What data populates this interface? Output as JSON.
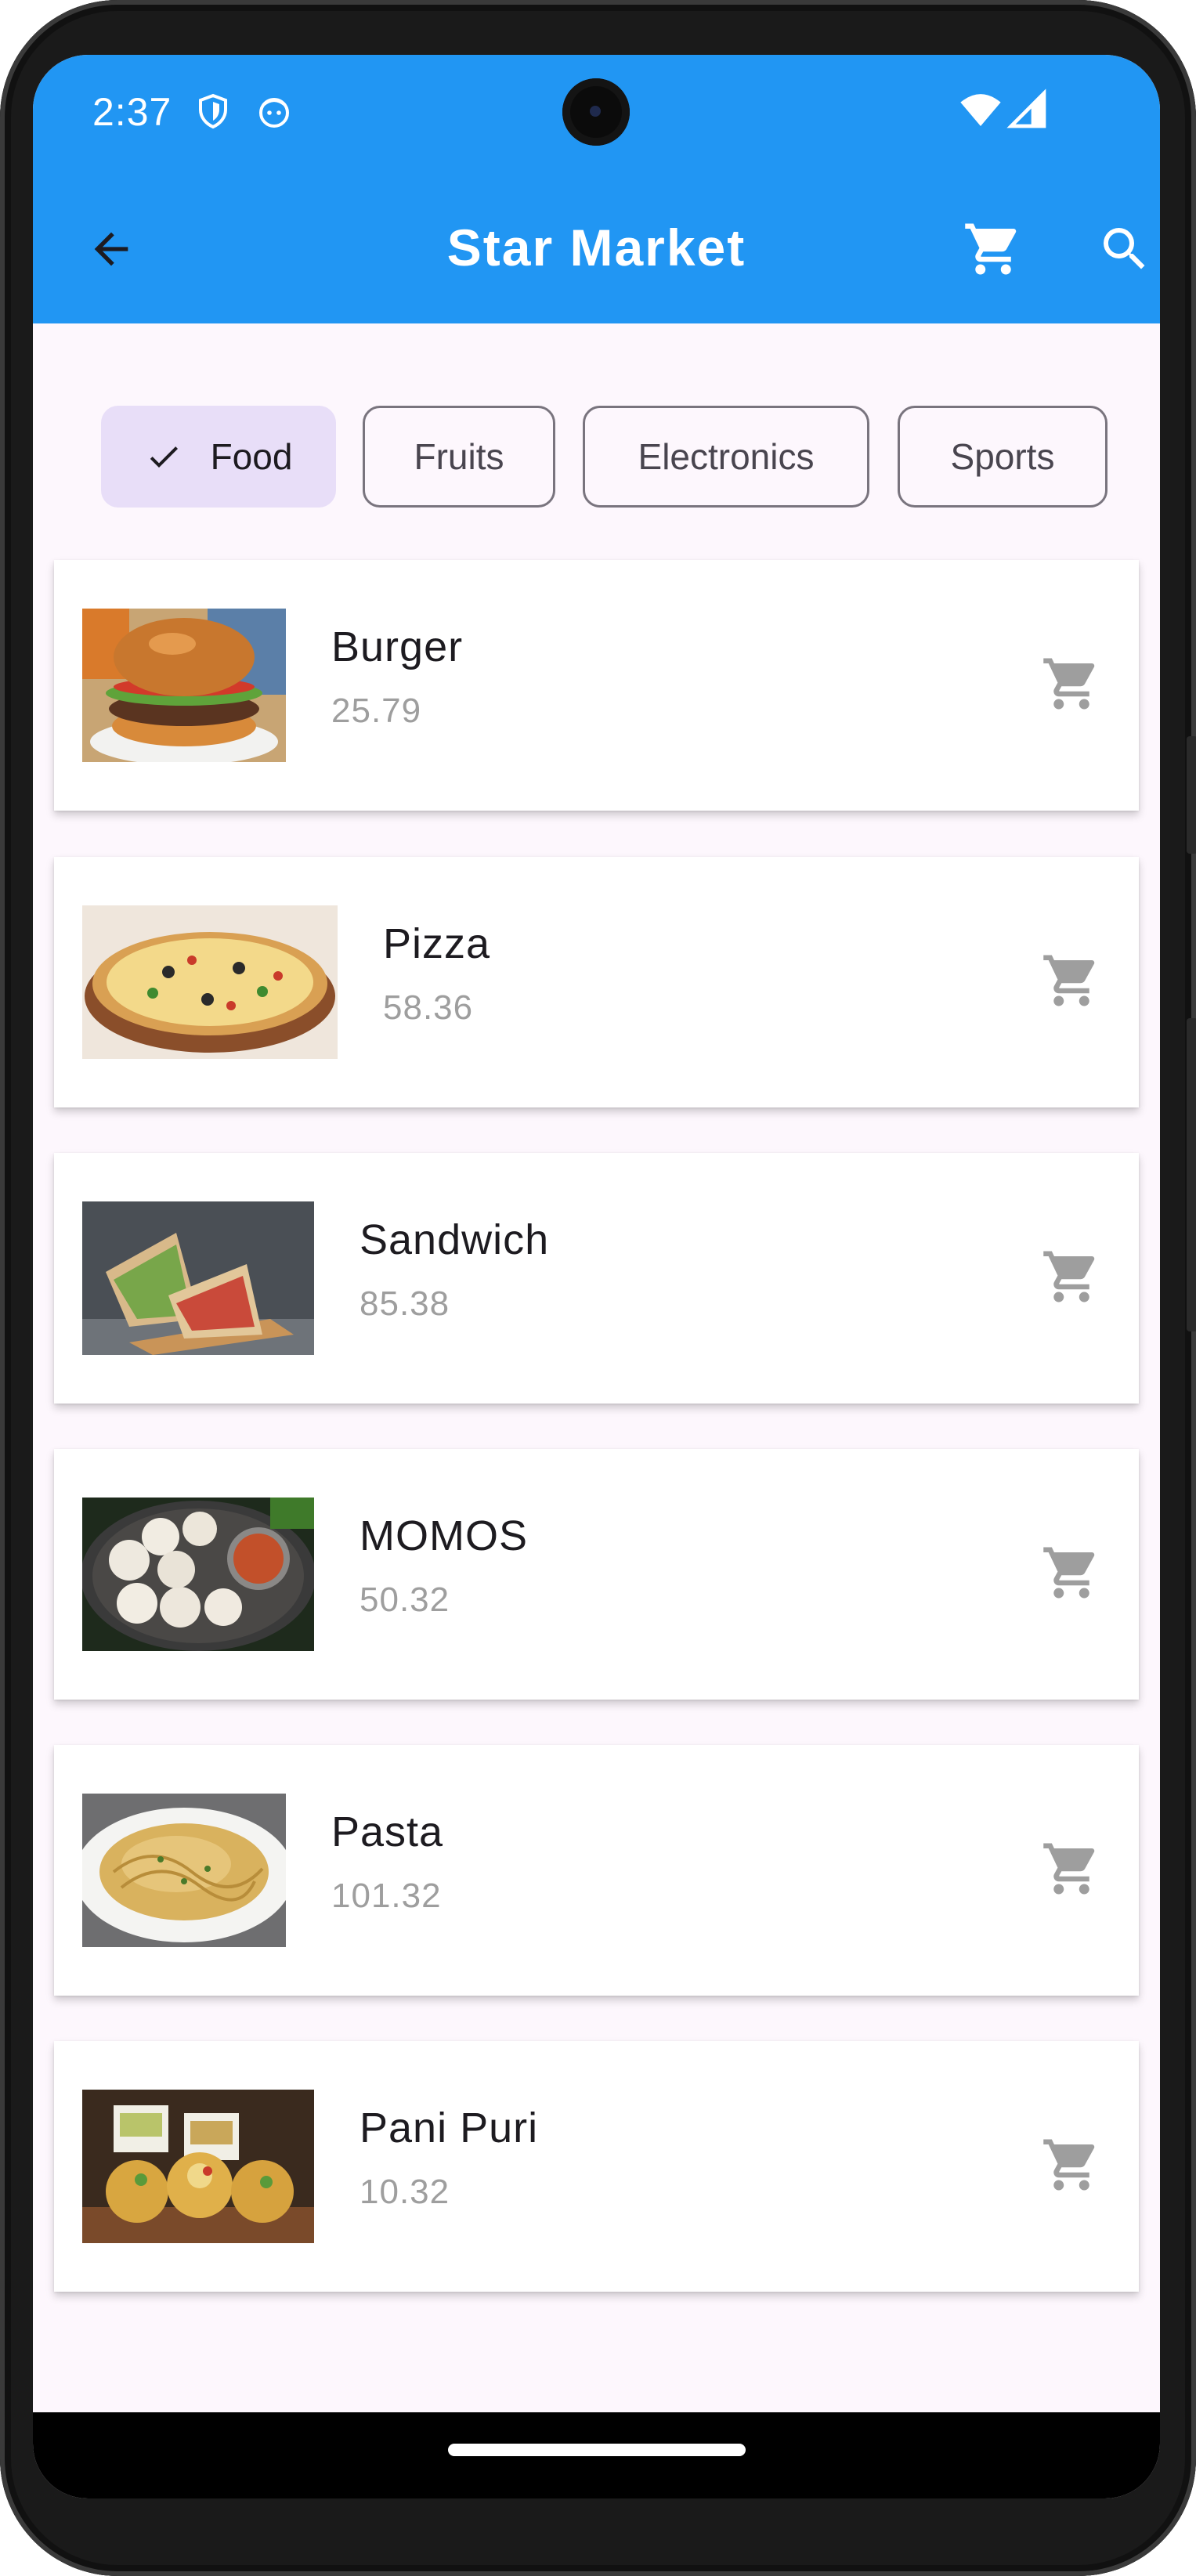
{
  "status_bar": {
    "time": "2:37",
    "icons": [
      "vpn-shield-icon",
      "notification-app-icon",
      "wifi-icon",
      "cellular-signal-icon"
    ]
  },
  "app_bar": {
    "title": "Star Market",
    "back_icon": "arrow-back-icon",
    "cart_icon": "shopping-cart-icon",
    "search_icon": "search-icon",
    "color": "#2196f3"
  },
  "categories": [
    {
      "label": "Food",
      "selected": true
    },
    {
      "label": "Fruits",
      "selected": false
    },
    {
      "label": "Electronics",
      "selected": false
    },
    {
      "label": "Sports",
      "selected": false
    }
  ],
  "products": [
    {
      "name": "Burger",
      "price": "25.79",
      "image": "burger-photo"
    },
    {
      "name": "Pizza",
      "price": "58.36",
      "image": "pizza-photo"
    },
    {
      "name": "Sandwich",
      "price": "85.38",
      "image": "sandwich-photo"
    },
    {
      "name": "MOMOS",
      "price": "50.32",
      "image": "momos-photo"
    },
    {
      "name": "Pasta",
      "price": "101.32",
      "image": "pasta-photo"
    },
    {
      "name": "Pani Puri",
      "price": "10.32",
      "image": "pani-puri-photo"
    }
  ],
  "colors": {
    "selected_chip": "#e8def8",
    "background": "#fdf7fd",
    "price_text": "#9e9e9e",
    "cart_icon": "#9e9e9e"
  }
}
